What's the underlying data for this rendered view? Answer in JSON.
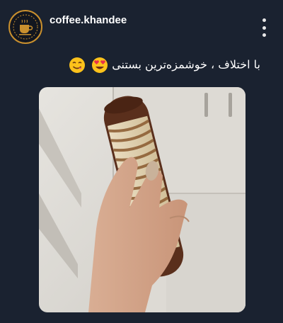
{
  "post": {
    "account_name": "coffee.khandee",
    "caption_text": "با اختلاف ، خوشمزه‌ترین بستنی",
    "caption_emojis": [
      "heart-eyes-emoji",
      "savoring-food-emoji"
    ],
    "more_icon": "vertical-ellipsis-icon",
    "avatar_icon": "coffee-cup-logo"
  },
  "colors": {
    "background": "#1a2230",
    "brand_gold": "#c9902e",
    "text": "#ffffff"
  }
}
